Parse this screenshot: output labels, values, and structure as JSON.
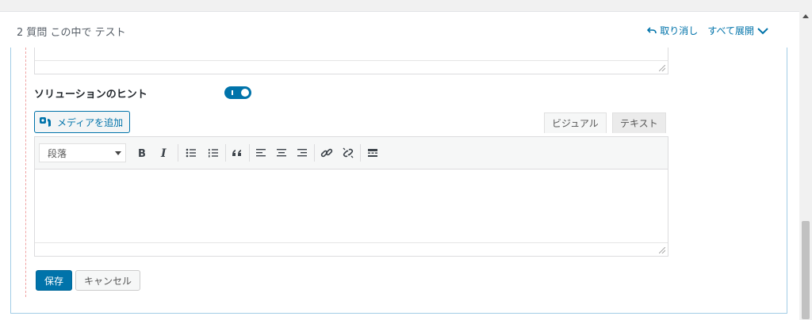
{
  "header": {
    "title": "2 質問 この中で テスト",
    "undo_label": "取り消し",
    "expand_all_label": "すべて展開"
  },
  "hint": {
    "label": "ソリューションのヒント",
    "toggle_on": true
  },
  "editor": {
    "add_media_label": "メディアを追加",
    "tabs": {
      "visual": "ビジュアル",
      "text": "テキスト"
    },
    "format_select_value": "段落",
    "toolbar_icons": [
      "bold-icon",
      "italic-icon",
      "bullet-list-icon",
      "numbered-list-icon",
      "blockquote-icon",
      "align-left-icon",
      "align-center-icon",
      "align-right-icon",
      "link-icon",
      "unlink-icon",
      "toolbar-toggle-icon"
    ],
    "content": ""
  },
  "actions": {
    "save_label": "保存",
    "cancel_label": "キャンセル"
  },
  "colors": {
    "accent": "#0073aa",
    "border_highlight": "#a2cde6",
    "dashed_guide": "#f0a2a2"
  }
}
